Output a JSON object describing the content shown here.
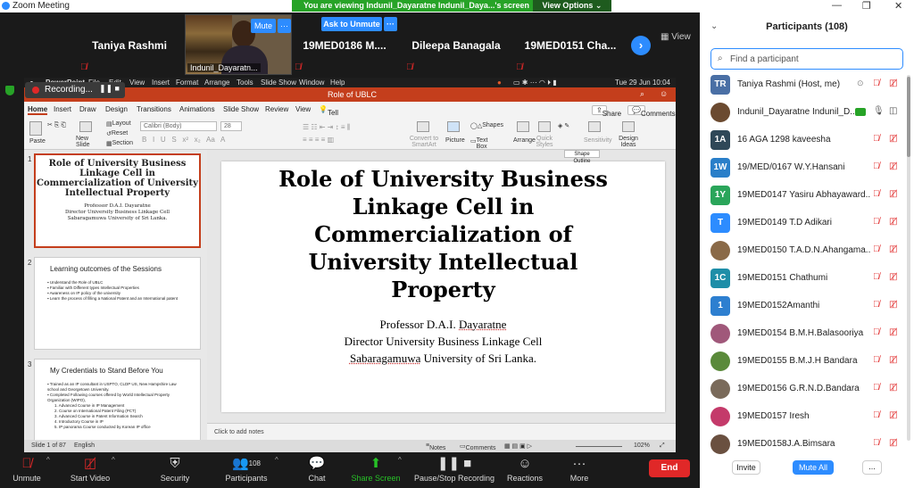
{
  "app_title": "Zoom Meeting",
  "window_controls": {
    "minimize": "—",
    "restore": "❐",
    "close": "✕"
  },
  "share_bar": {
    "message": "You are viewing Indunil_Dayaratne Indunil_Daya...'s screen",
    "view_options": "View Options ⌄"
  },
  "gallery": {
    "tiles": [
      "Taniya Rashmi",
      "19MED0186  M....",
      "Dileepa Banagala",
      "19MED0151  Cha..."
    ],
    "video_name": "Indunil_Dayaratn...",
    "mute_label": "Mute",
    "more_label": "···",
    "ask_unmute": "Ask to Unmute",
    "next": "›",
    "view_label": "View"
  },
  "recording": {
    "label": "Recording...",
    "controls": "❚❚ ■"
  },
  "ppt": {
    "menubar": [
      "PowerPoint",
      "File",
      "Edit",
      "View",
      "Insert",
      "Format",
      "Arrange",
      "Tools",
      "Slide Show",
      "Window",
      "Help"
    ],
    "clock": "Tue 29 Jun  10:04",
    "doc_title": "Role of UBLC",
    "tabs": [
      "Home",
      "Insert",
      "Draw",
      "Design",
      "Transitions",
      "Animations",
      "Slide Show",
      "Review",
      "View",
      "Tell me"
    ],
    "share": "Share",
    "comments": "Comments",
    "ribbon": {
      "paste": "Paste",
      "new_slide": "New Slide",
      "layout": "Layout",
      "reset": "Reset",
      "section": "Section",
      "font": "Calibri (Body)",
      "size": "28",
      "convert": "Convert to SmartArt",
      "picture": "Picture",
      "shapes": "Shapes",
      "textbox": "Text Box",
      "arrange": "Arrange",
      "quick_styles": "Quick Styles",
      "sensitivity": "Sensitivity",
      "design_ideas": "Design Ideas",
      "tooltip": "Shape Outline"
    },
    "thumbs": {
      "t1_title": "Role of University Business Linkage Cell in Commercialization of University Intellectual Property",
      "t1_sub": [
        "Professor D.A.I. Dayaratne",
        "Director University Business Linkage Cell",
        "Sabaragamuwa University of Sri Lanka."
      ],
      "t2_title": "Learning outcomes of the Sessions",
      "t2_bullets": [
        "Understand the Role of UBLC",
        "Familiar with Different types Intellectual Properties",
        "Awareness on IP policy of the university",
        "Learn the process of filling a National Patent and an International patent"
      ],
      "t3_title": "My Credentials to Stand Before You",
      "t3_bullets": [
        "Trained as an IP consultant in USPTO, CLDP US, New Hampshire Law school and Georgetown University.",
        "Completed Following courses offered by World Intellectual Property Organization (WIPO),"
      ],
      "t3_sub": [
        "1. Advanced Course in IP Management",
        "2. Course on International Patent Filing (PCT)",
        "3. Advanced Course in Patent Information Search",
        "4. Introductory Course in IP",
        "5. IP panorama Course conducted by Korean IP office"
      ]
    },
    "slide": {
      "title": [
        "Role of University Business",
        "Linkage Cell in",
        "Commercialization of",
        "University Intellectual",
        "Property"
      ],
      "line1_prefix": "Professor D.A.I. ",
      "line1_ul": "Dayaratne",
      "line2": "Director University Business Linkage Cell",
      "line3_ul": "Sabaragamuwa",
      "line3_suffix": " University of Sri Lanka."
    },
    "notes_placeholder": "Click to add notes",
    "status": {
      "slide": "Slide 1 of 87",
      "lang": "English",
      "notes": "Notes",
      "comments": "Comments",
      "zoom": "102%"
    }
  },
  "toolbar": {
    "unmute": "Unmute",
    "start_video": "Start Video",
    "security": "Security",
    "participants": "Participants",
    "participants_count": "108",
    "chat": "Chat",
    "share_screen": "Share Screen",
    "pause_recording": "Pause/Stop Recording",
    "reactions": "Reactions",
    "more": "More",
    "end": "End"
  },
  "panel": {
    "title": "Participants (108)",
    "search_placeholder": "Find a participant",
    "participants": [
      {
        "initials": "TR",
        "name": "Taniya Rashmi (Host, me)",
        "color": "#4a6fa5"
      },
      {
        "initials": "",
        "name": "Indunil_Dayaratne Indunil_D...",
        "color": "#6b4a30"
      },
      {
        "initials": "1A",
        "name": "16 AGA 1298 kaveesha",
        "color": "#2f4858"
      },
      {
        "initials": "1W",
        "name": "19/MED/0167 W.Y.Hansani",
        "color": "#2a7fc9"
      },
      {
        "initials": "1Y",
        "name": "19MED0147 Yasiru Abhayaward...",
        "color": "#2aa55a"
      },
      {
        "initials": "T",
        "name": "19MED0149 T.D Adikari",
        "color": "#2d8cff"
      },
      {
        "initials": "",
        "name": "19MED0150 T.A.D.N.Ahangama...",
        "color": "#8a6a48"
      },
      {
        "initials": "1C",
        "name": "19MED0151 Chathumi",
        "color": "#1e8ea8"
      },
      {
        "initials": "1",
        "name": "19MED0152Amanthi",
        "color": "#2d7fd0"
      },
      {
        "initials": "",
        "name": "19MED0154 B.M.H.Balasooriya",
        "color": "#a0587a"
      },
      {
        "initials": "",
        "name": "19MED0155 B.M.J.H Bandara",
        "color": "#5a8a3a"
      },
      {
        "initials": "",
        "name": "19MED0156 G.R.N.D.Bandara",
        "color": "#7a6a5a"
      },
      {
        "initials": "",
        "name": "19MED0157 Iresh",
        "color": "#c43a6a"
      },
      {
        "initials": "",
        "name": "19MED0158J.A.Bimsara",
        "color": "#6a5040"
      }
    ],
    "invite": "Invite",
    "mute_all": "Mute All",
    "more": "..."
  }
}
